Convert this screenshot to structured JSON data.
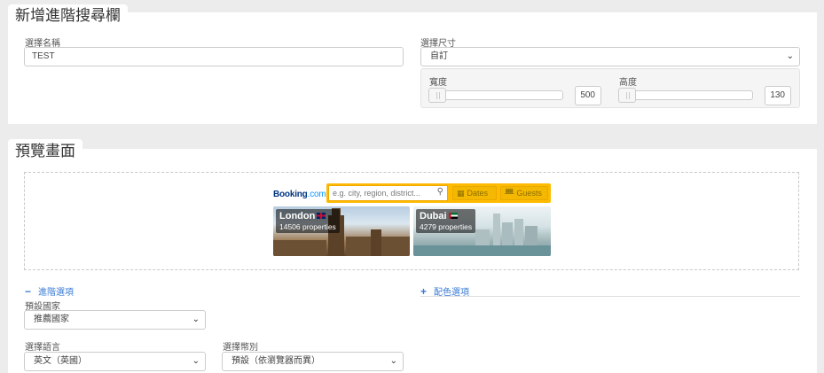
{
  "section1": {
    "title": "新增進階搜尋欄",
    "name_label": "選擇名稱",
    "name_value": "TEST",
    "size_label": "選擇尺寸",
    "size_value": "自訂",
    "width_label": "寬度",
    "width_value": "500",
    "height_label": "高度",
    "height_value": "130"
  },
  "section2": {
    "title": "預覽畫面",
    "widget": {
      "logo_brand": "Booking",
      "logo_suffix": ".com",
      "search_placeholder": "e.g. city, region, district...",
      "dates_label": "Dates",
      "guests_label": "Guests",
      "cards": [
        {
          "city": "London",
          "properties": "14506 properties"
        },
        {
          "city": "Dubai",
          "properties": "4279 properties"
        }
      ]
    },
    "advanced_link": "進階選項",
    "color_link": "配色選項",
    "country_label": "預設國家",
    "country_value": "推薦國家",
    "language_label": "選擇語言",
    "language_value": "英文（英國）",
    "currency_label": "選擇幣別",
    "currency_value": "預設（依瀏覽器而異）"
  },
  "colors": {
    "accent": "#3a7bd5",
    "booking_yellow": "#febb02",
    "booking_blue": "#003580"
  }
}
